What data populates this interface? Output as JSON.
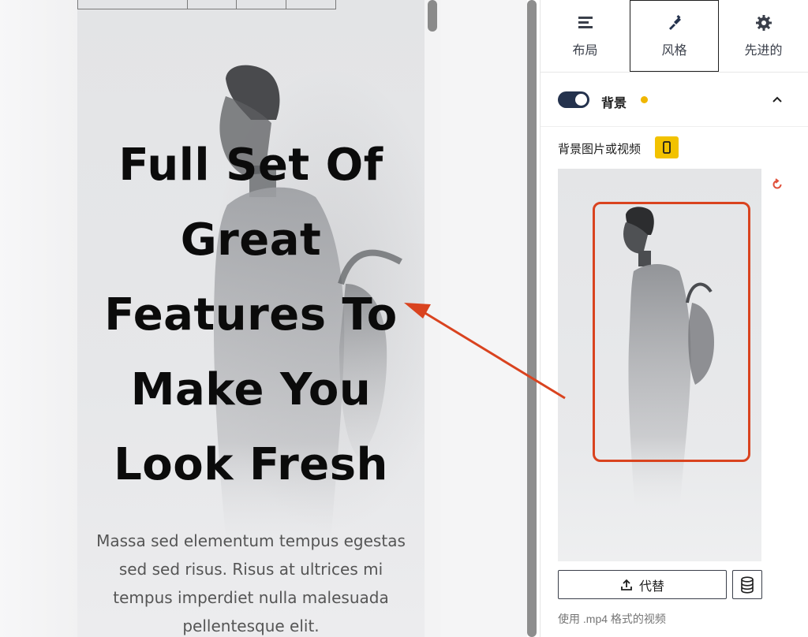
{
  "preview": {
    "headline_lines": [
      "Full Set Of",
      "Great",
      "Features To",
      "Make You",
      "Look Fresh"
    ],
    "body_lines": [
      "Massa sed elementum tempus egestas",
      "sed sed risus. Risus at ultrices mi",
      "tempus imperdiet nulla malesuada",
      "pellentesque elit."
    ]
  },
  "panel": {
    "tabs": [
      {
        "label": "布局",
        "icon": "layout-icon"
      },
      {
        "label": "风格",
        "icon": "brush-icon"
      },
      {
        "label": "先进的",
        "icon": "gear-icon"
      }
    ],
    "active_tab": "风格",
    "section_title": "背景",
    "media_label": "背景图片或视频",
    "replace_label": "代替",
    "help_text": "使用 .mp4 格式的视频"
  },
  "colors": {
    "accent_toggle": "#24324d",
    "status_dot": "#f0b600",
    "highlight": "#d9431f",
    "badge": "#f2c200"
  }
}
